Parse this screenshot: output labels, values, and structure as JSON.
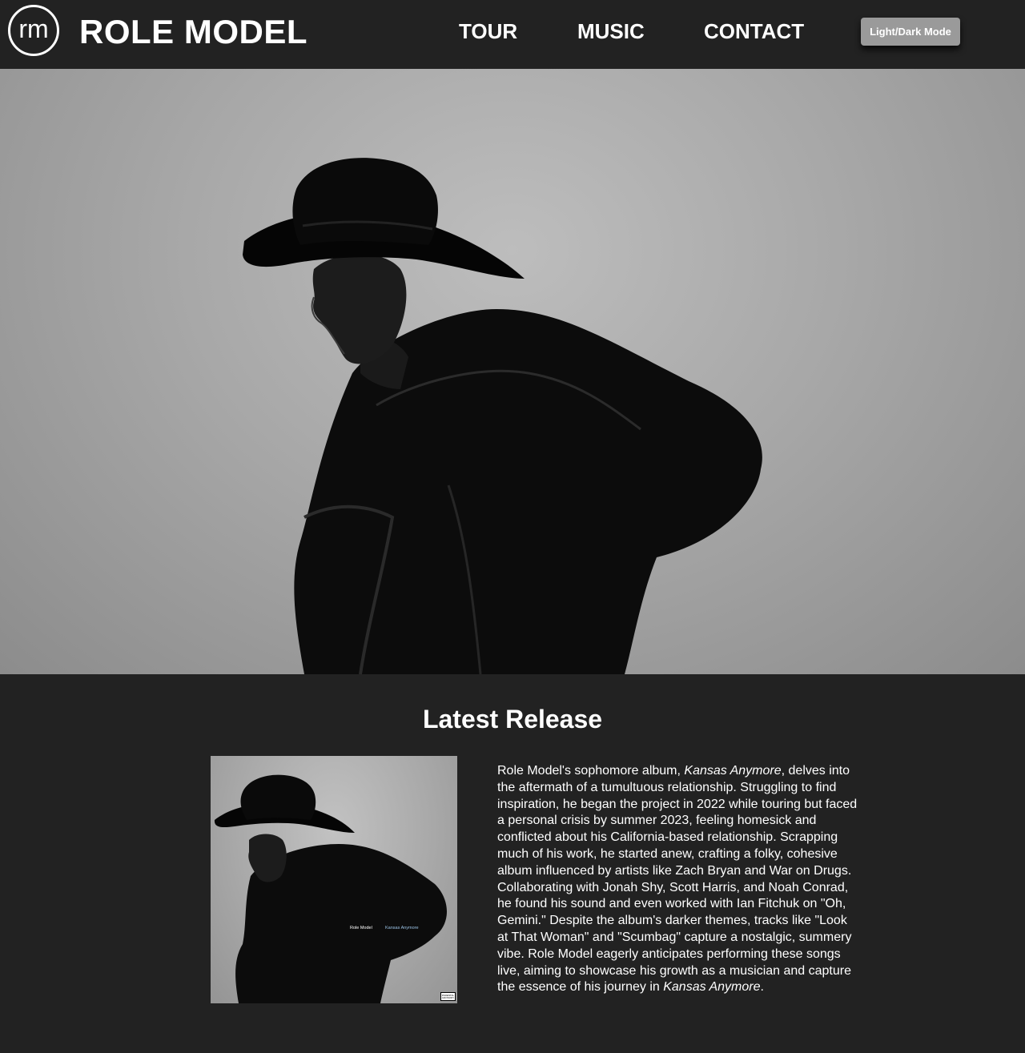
{
  "header": {
    "logo_text": "rm",
    "title": "ROLE MODEL",
    "nav": [
      {
        "label": "TOUR"
      },
      {
        "label": "MUSIC"
      },
      {
        "label": "CONTACT"
      }
    ],
    "mode_button_label": "Light/Dark Mode"
  },
  "hero": {
    "image": "black-and-white portrait of person in cowboy hat and leather jacket, facing away"
  },
  "latest_release": {
    "title": "Latest Release",
    "album_cover": {
      "artist_label": "Role Model",
      "album_label": "Kansas Anymore",
      "advisory_label": "PARENTAL ADVISORY"
    },
    "description": {
      "part1": "Role Model's sophomore album, ",
      "album_name_1": "Kansas Anymore",
      "part2": ", delves into the aftermath of a tumultuous relationship. Struggling to find inspiration, he began the project in 2022 while touring but faced a personal crisis by summer 2023, feeling homesick and conflicted about his California-based relationship. Scrapping much of his work, he started anew, crafting a folky, cohesive album influenced by artists like Zach Bryan and War on Drugs. Collaborating with Jonah Shy, Scott Harris, and Noah Conrad, he found his sound and even worked with Ian Fitchuk on \"Oh, Gemini.\" Despite the album's darker themes, tracks like \"Look at That Woman\" and \"Scumbag\" capture a nostalgic, summery vibe. Role Model eagerly anticipates performing these songs live, aiming to showcase his growth as a musician and capture the essence of his journey in ",
      "album_name_2": "Kansas Anymore",
      "part3": "."
    }
  },
  "colors": {
    "background": "#222222",
    "text": "#ffffff",
    "button": "#9a9a9a",
    "album_label_accent": "#9bc3e6"
  },
  "icons": {
    "logo": "rm-circle-logo"
  }
}
